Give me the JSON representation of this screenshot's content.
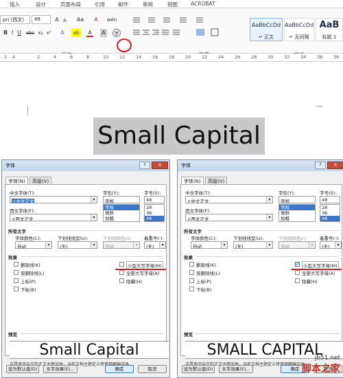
{
  "ribbon": {
    "tabs": [
      "插入",
      "设计",
      "页面布局",
      "引用",
      "邮件",
      "审阅",
      "视图",
      "ACROBAT"
    ],
    "font_name": "pri (西文)",
    "font_size": "48",
    "grow_font": "A",
    "shrink_font": "A",
    "aa_label": "Aa",
    "clear_fmt": "A",
    "wen_label": "wén",
    "bold": "B",
    "italic": "I",
    "underline": "U",
    "strike": "abc",
    "subscript": "x₂",
    "superscript": "x²",
    "text_effect": "A",
    "highlight": "ab",
    "font_color": "A",
    "char_shade": "A",
    "enclose": "字",
    "group_font_label": "字体",
    "group_para_label": "段落",
    "group_style_label": "样式",
    "styles": [
      {
        "sample": "AaBbCcDd",
        "name": "↵ 正文"
      },
      {
        "sample": "AaBbCcDd",
        "name": "↵ 无间隔"
      },
      {
        "sample": "AaB",
        "name": "标题 1"
      }
    ],
    "ruler_ticks": [
      "2",
      "4",
      "2",
      "4",
      "6",
      "8",
      "10",
      "12",
      "14",
      "16",
      "18",
      "20",
      "22",
      "24",
      "26",
      "28",
      "30",
      "32",
      "34",
      "36",
      "38"
    ]
  },
  "document": {
    "title_text": "Small Capital"
  },
  "dialogs": [
    {
      "title": "字体",
      "help": "?",
      "close": "X",
      "tab_font": "字体(N)",
      "tab_adv": "高级(V)",
      "cn_font_label": "中文字体(T):",
      "cn_font_value": "+中文正文",
      "west_font_label": "西文字体(F):",
      "west_font_value": "+西文正文",
      "style_label": "字形(Y):",
      "style_value": "常规",
      "style_list": [
        "常规",
        "倾斜",
        "加粗"
      ],
      "size_label": "字号(S):",
      "size_value": "48",
      "size_list": [
        "28",
        "36",
        "48"
      ],
      "all_text_label": "所有文字",
      "color_label": "字体颜色(C):",
      "color_value": "自动",
      "ul_type_label": "下划线线型(U):",
      "ul_type_value": "(无)",
      "ul_color_label": "下划线颜色(I):",
      "ul_color_value": "自动",
      "emph_label": "着重号(·):",
      "emph_value": "(无)",
      "effects_label": "效果",
      "effects_left": [
        "删除线(K)",
        "双删除线(L)",
        "上标(P)",
        "下标(B)"
      ],
      "effects_right": [
        "小型大写字母(M)",
        "全部大写字母(A)",
        "隐藏(H)"
      ],
      "smallcaps_checked": false,
      "preview_label": "预览",
      "preview_text": "Small Capital",
      "note": "这是用于中文的正文主题字体。当前文档主题定义将使用哪种字体。",
      "btn_default": "设为默认值(D)",
      "btn_effects": "文字效果(E)...",
      "btn_ok": "确定",
      "btn_cancel": "取消"
    },
    {
      "title": "字体",
      "help": "?",
      "close": "X",
      "tab_font": "字体(N)",
      "tab_adv": "高级(V)",
      "cn_font_label": "中文字体(T):",
      "cn_font_value": "+中文正文",
      "west_font_label": "西文字体(F):",
      "west_font_value": "+西文正文",
      "style_label": "字形(Y):",
      "style_value": "常规",
      "style_list": [
        "常规",
        "倾斜",
        "加粗"
      ],
      "size_label": "字号(S):",
      "size_value": "48",
      "size_list": [
        "28",
        "36",
        "48"
      ],
      "all_text_label": "所有文字",
      "color_label": "字体颜色(C):",
      "color_value": "自动",
      "ul_type_label": "下划线线型(U):",
      "ul_type_value": "(无)",
      "ul_color_label": "下划线颜色(I):",
      "ul_color_value": "自动",
      "emph_label": "着重号(·):",
      "emph_value": "(无)",
      "effects_label": "效果",
      "effects_left": [
        "删除线(K)",
        "双删除线(L)",
        "上标(P)",
        "下标(B)"
      ],
      "effects_right": [
        "小型大写字母(M)",
        "全部大写字母(A)",
        "隐藏(H)"
      ],
      "smallcaps_checked": true,
      "preview_label": "预览",
      "preview_text": "SMALL CAPITAL",
      "note": "这是用于中文的正文主题字体。当前文档主题定义将使用哪种字体。",
      "btn_default": "设为默认值(D)",
      "btn_effects": "文字效果(E)...",
      "btn_ok": "确定",
      "btn_cancel": "取消"
    }
  ],
  "watermark": {
    "url": "jb51.net",
    "site": "脚本之家"
  },
  "colors": {
    "annotation_red": "#d6192b",
    "selection_blue": "#3c76c9",
    "title_bg": "#c8c8c8"
  }
}
